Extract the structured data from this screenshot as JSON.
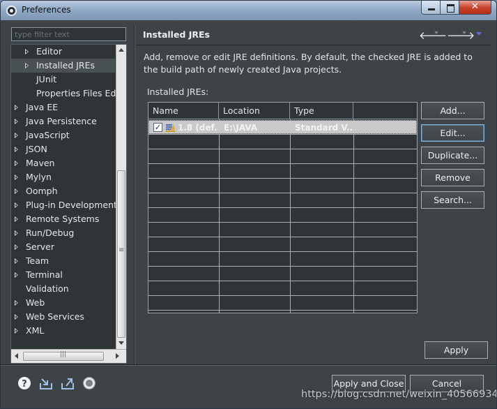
{
  "window": {
    "title": "Preferences"
  },
  "filter": {
    "placeholder": "type filter text"
  },
  "tree": {
    "items": [
      {
        "label": "Editor",
        "indent": 1,
        "expandable": true
      },
      {
        "label": "Installed JREs",
        "indent": 1,
        "expandable": true,
        "selected": true
      },
      {
        "label": "JUnit",
        "indent": 1,
        "expandable": false
      },
      {
        "label": "Properties Files Editor",
        "indent": 1,
        "expandable": false
      },
      {
        "label": "Java EE",
        "indent": 0,
        "expandable": true
      },
      {
        "label": "Java Persistence",
        "indent": 0,
        "expandable": true
      },
      {
        "label": "JavaScript",
        "indent": 0,
        "expandable": true
      },
      {
        "label": "JSON",
        "indent": 0,
        "expandable": true
      },
      {
        "label": "Maven",
        "indent": 0,
        "expandable": true
      },
      {
        "label": "Mylyn",
        "indent": 0,
        "expandable": true
      },
      {
        "label": "Oomph",
        "indent": 0,
        "expandable": true
      },
      {
        "label": "Plug-in Development",
        "indent": 0,
        "expandable": true
      },
      {
        "label": "Remote Systems",
        "indent": 0,
        "expandable": true
      },
      {
        "label": "Run/Debug",
        "indent": 0,
        "expandable": true
      },
      {
        "label": "Server",
        "indent": 0,
        "expandable": true
      },
      {
        "label": "Team",
        "indent": 0,
        "expandable": true
      },
      {
        "label": "Terminal",
        "indent": 0,
        "expandable": true
      },
      {
        "label": "Validation",
        "indent": 0,
        "expandable": false
      },
      {
        "label": "Web",
        "indent": 0,
        "expandable": true
      },
      {
        "label": "Web Services",
        "indent": 0,
        "expandable": true
      },
      {
        "label": "XML",
        "indent": 0,
        "expandable": true
      }
    ]
  },
  "page": {
    "title": "Installed JREs",
    "description": "Add, remove or edit JRE definitions. By default, the checked JRE is added to the build path of newly created Java projects.",
    "section_label": "Installed JREs:"
  },
  "table": {
    "columns": [
      "Name",
      "Location",
      "Type",
      ""
    ],
    "rows": [
      {
        "checked": true,
        "name": "1.8 (def...",
        "location": "E:\\JAVA",
        "type": "Standard V..."
      }
    ]
  },
  "buttons": {
    "add": "Add...",
    "edit": "Edit...",
    "duplicate": "Duplicate...",
    "remove": "Remove",
    "search": "Search...",
    "apply": "Apply",
    "apply_and_close": "Apply and Close",
    "cancel": "Cancel"
  },
  "bottom_icons": [
    "help-icon",
    "import-icon",
    "export-icon",
    "oomph-record-icon"
  ],
  "watermark": "https://blog.csdn.net/weixin_40566934",
  "colors": {
    "background": "#3d4346",
    "tree_background": "#2f3436",
    "selected_row": "#c9c9c9",
    "close_button": "#c6402a"
  }
}
